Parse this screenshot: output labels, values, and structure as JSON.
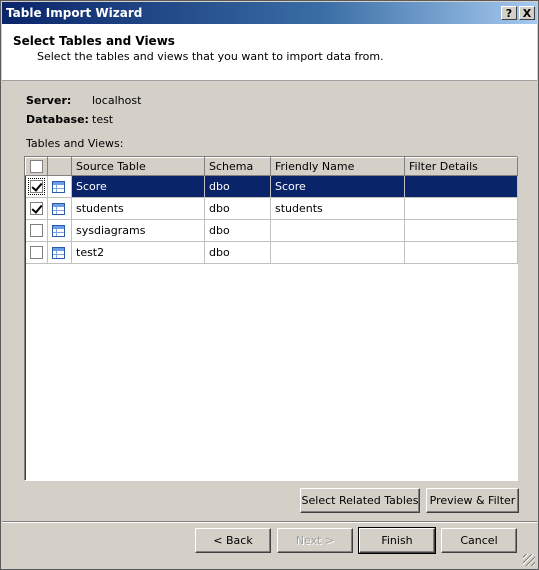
{
  "window": {
    "title": "Table Import Wizard",
    "help_label": "?",
    "close_label": "X"
  },
  "header": {
    "title": "Select Tables and Views",
    "subtitle": "Select the tables and views that you want to import data from."
  },
  "connection": {
    "server_label": "Server:",
    "server_value": "localhost",
    "database_label": "Database:",
    "database_value": "test"
  },
  "grid": {
    "label": "Tables and Views:",
    "columns": [
      "Source Table",
      "Schema",
      "Friendly Name",
      "Filter Details"
    ],
    "rows": [
      {
        "checked": true,
        "selected": true,
        "source": "Score",
        "schema": "dbo",
        "friendly": "Score",
        "filter": ""
      },
      {
        "checked": true,
        "selected": false,
        "source": "students",
        "schema": "dbo",
        "friendly": "students",
        "filter": ""
      },
      {
        "checked": false,
        "selected": false,
        "source": "sysdiagrams",
        "schema": "dbo",
        "friendly": "",
        "filter": ""
      },
      {
        "checked": false,
        "selected": false,
        "source": "test2",
        "schema": "dbo",
        "friendly": "",
        "filter": ""
      }
    ]
  },
  "actions": {
    "select_related": "Select Related Tables",
    "preview_filter": "Preview & Filter"
  },
  "footer": {
    "back": "< Back",
    "next": "Next >",
    "finish": "Finish",
    "cancel": "Cancel"
  },
  "colors": {
    "title_start": "#0a246a",
    "title_end": "#a6caf0",
    "selection": "#0a246a",
    "face": "#d4d0c8"
  },
  "icons": {
    "row_icon": "table-icon",
    "help": "help-icon",
    "close": "close-icon"
  }
}
